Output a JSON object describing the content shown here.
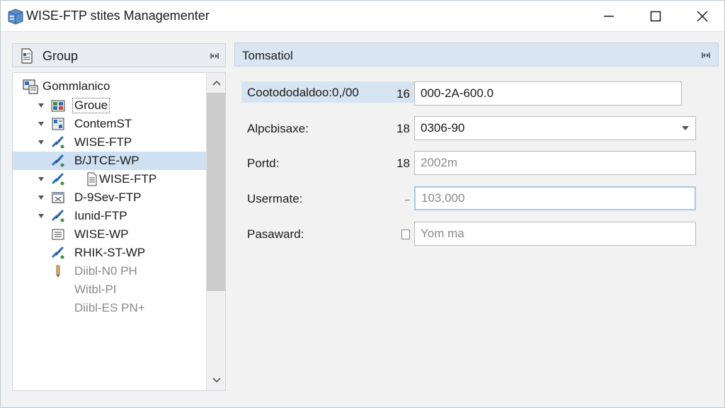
{
  "window": {
    "title": "WISE-FTP stites Managementer",
    "icon": "server-box-icon"
  },
  "left_panel": {
    "header_label": "Group",
    "root": {
      "label": "Gommlanico"
    },
    "items": [
      {
        "label": "Groue",
        "expander": true,
        "icon": "group-folder-icon",
        "focused": true
      },
      {
        "label": "ContemST",
        "expander": true,
        "icon": "content-icon"
      },
      {
        "label": "WISE-FTP",
        "expander": true,
        "icon": "ftp-link-icon"
      },
      {
        "label": "B/JTCE-WP",
        "expander": false,
        "icon": "ftp-link-icon",
        "selected": true
      },
      {
        "label": "WISE-FTP",
        "expander": true,
        "icon": "ftp-link-icon",
        "doc": true
      },
      {
        "label": "D-9Sev-FTP",
        "expander": true,
        "icon": "window-icon"
      },
      {
        "label": "Iunid-FTP",
        "expander": true,
        "icon": "ftp-link-icon"
      },
      {
        "label": "WISE-WP",
        "expander": false,
        "icon": "list-icon"
      },
      {
        "label": "RHIK-ST-WP",
        "expander": false,
        "icon": "ftp-link-icon"
      },
      {
        "label": "Diibl-N0 PH",
        "expander": false,
        "icon": "pencil-icon",
        "dim": true
      },
      {
        "label": "Witbl-PI",
        "expander": false,
        "dim": true
      },
      {
        "label": "Diibl-ES PN+",
        "expander": false,
        "dim": true
      }
    ]
  },
  "right_panel": {
    "header_label": "Tomsatiol",
    "fields": [
      {
        "label": "Cootododaldoo:0,/00",
        "num": "16",
        "value": "000-2A-600.0",
        "kind": "text",
        "highlight": true
      },
      {
        "label": "Alpcbisaxe:",
        "num": "18",
        "value": "0306-90",
        "kind": "select"
      },
      {
        "label": "Portd:",
        "num": "18",
        "value": "2002m",
        "kind": "text",
        "muted": true
      },
      {
        "label": "Usermate:",
        "num": "–",
        "value": "103,000",
        "kind": "text",
        "muted": true,
        "focused": true
      },
      {
        "label": "Pasaward:",
        "num": "",
        "value": "Yom ma",
        "kind": "password",
        "muted": true
      }
    ]
  },
  "colors": {
    "selection": "#cfe0f3",
    "header_blue": "#d9e6f2",
    "link_icon": "#2f6db5"
  }
}
